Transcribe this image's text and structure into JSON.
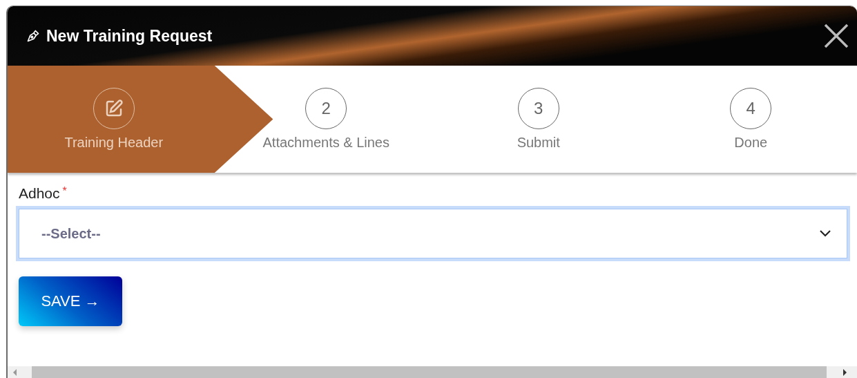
{
  "window": {
    "title": "New Training Request"
  },
  "steps": [
    {
      "kind": "icon",
      "label": "Training Header",
      "selected": true
    },
    {
      "kind": "number",
      "number": "2",
      "label": "Attachments & Lines",
      "selected": false
    },
    {
      "kind": "number",
      "number": "3",
      "label": "Submit",
      "selected": false
    },
    {
      "kind": "number",
      "number": "4",
      "label": "Done",
      "selected": false
    }
  ],
  "form": {
    "field_label": "Adhoc",
    "required_mark": "*",
    "select_value": "--Select--",
    "focused": true
  },
  "save_button": "SAVE →"
}
